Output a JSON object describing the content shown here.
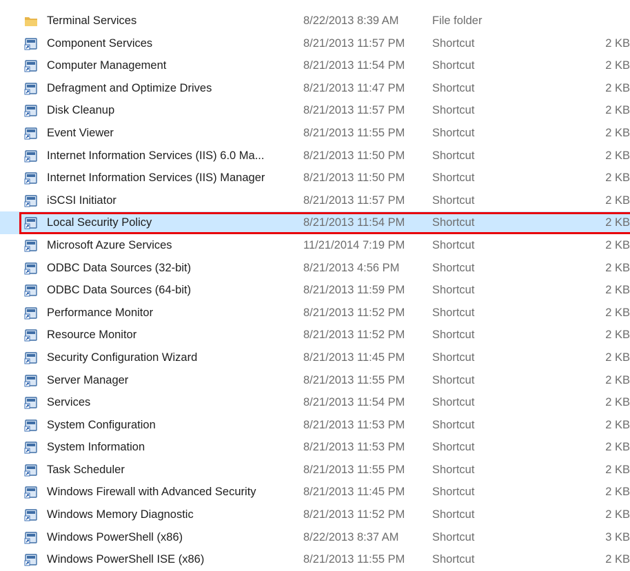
{
  "file_list": {
    "rows": [
      {
        "name": "Terminal Services",
        "date": "8/22/2013 8:39 AM",
        "type": "File folder",
        "size": "",
        "icon": "folder-icon"
      },
      {
        "name": "Component Services",
        "date": "8/21/2013 11:57 PM",
        "type": "Shortcut",
        "size": "2 KB",
        "icon": "component-services-icon"
      },
      {
        "name": "Computer Management",
        "date": "8/21/2013 11:54 PM",
        "type": "Shortcut",
        "size": "2 KB",
        "icon": "computer-management-icon"
      },
      {
        "name": "Defragment and Optimize Drives",
        "date": "8/21/2013 11:47 PM",
        "type": "Shortcut",
        "size": "2 KB",
        "icon": "defragment-icon"
      },
      {
        "name": "Disk Cleanup",
        "date": "8/21/2013 11:57 PM",
        "type": "Shortcut",
        "size": "2 KB",
        "icon": "disk-cleanup-icon"
      },
      {
        "name": "Event Viewer",
        "date": "8/21/2013 11:55 PM",
        "type": "Shortcut",
        "size": "2 KB",
        "icon": "event-viewer-icon"
      },
      {
        "name": "Internet Information Services (IIS) 6.0 Ma...",
        "date": "8/21/2013 11:50 PM",
        "type": "Shortcut",
        "size": "2 KB",
        "icon": "iis6-manager-icon"
      },
      {
        "name": "Internet Information Services (IIS) Manager",
        "date": "8/21/2013 11:50 PM",
        "type": "Shortcut",
        "size": "2 KB",
        "icon": "iis-manager-icon"
      },
      {
        "name": "iSCSI Initiator",
        "date": "8/21/2013 11:57 PM",
        "type": "Shortcut",
        "size": "2 KB",
        "icon": "iscsi-initiator-icon"
      },
      {
        "name": "Local Security Policy",
        "date": "8/21/2013 11:54 PM",
        "type": "Shortcut",
        "size": "2 KB",
        "icon": "local-security-policy-icon"
      },
      {
        "name": "Microsoft Azure Services",
        "date": "11/21/2014 7:19 PM",
        "type": "Shortcut",
        "size": "2 KB",
        "icon": "azure-services-icon"
      },
      {
        "name": "ODBC Data Sources (32-bit)",
        "date": "8/21/2013 4:56 PM",
        "type": "Shortcut",
        "size": "2 KB",
        "icon": "odbc-icon"
      },
      {
        "name": "ODBC Data Sources (64-bit)",
        "date": "8/21/2013 11:59 PM",
        "type": "Shortcut",
        "size": "2 KB",
        "icon": "odbc-icon"
      },
      {
        "name": "Performance Monitor",
        "date": "8/21/2013 11:52 PM",
        "type": "Shortcut",
        "size": "2 KB",
        "icon": "performance-monitor-icon"
      },
      {
        "name": "Resource Monitor",
        "date": "8/21/2013 11:52 PM",
        "type": "Shortcut",
        "size": "2 KB",
        "icon": "resource-monitor-icon"
      },
      {
        "name": "Security Configuration Wizard",
        "date": "8/21/2013 11:45 PM",
        "type": "Shortcut",
        "size": "2 KB",
        "icon": "security-wizard-icon"
      },
      {
        "name": "Server Manager",
        "date": "8/21/2013 11:55 PM",
        "type": "Shortcut",
        "size": "2 KB",
        "icon": "server-manager-icon"
      },
      {
        "name": "Services",
        "date": "8/21/2013 11:54 PM",
        "type": "Shortcut",
        "size": "2 KB",
        "icon": "services-icon"
      },
      {
        "name": "System Configuration",
        "date": "8/21/2013 11:53 PM",
        "type": "Shortcut",
        "size": "2 KB",
        "icon": "system-configuration-icon"
      },
      {
        "name": "System Information",
        "date": "8/21/2013 11:53 PM",
        "type": "Shortcut",
        "size": "2 KB",
        "icon": "system-information-icon"
      },
      {
        "name": "Task Scheduler",
        "date": "8/21/2013 11:55 PM",
        "type": "Shortcut",
        "size": "2 KB",
        "icon": "task-scheduler-icon"
      },
      {
        "name": "Windows Firewall with Advanced Security",
        "date": "8/21/2013 11:45 PM",
        "type": "Shortcut",
        "size": "2 KB",
        "icon": "firewall-icon"
      },
      {
        "name": "Windows Memory Diagnostic",
        "date": "8/21/2013 11:52 PM",
        "type": "Shortcut",
        "size": "2 KB",
        "icon": "memory-diagnostic-icon"
      },
      {
        "name": "Windows PowerShell (x86)",
        "date": "8/22/2013 8:37 AM",
        "type": "Shortcut",
        "size": "3 KB",
        "icon": "powershell-icon"
      },
      {
        "name": "Windows PowerShell ISE (x86)",
        "date": "8/21/2013 11:55 PM",
        "type": "Shortcut",
        "size": "2 KB",
        "icon": "powershell-ise-icon"
      }
    ],
    "selected_name": "Local Security Policy",
    "colors": {
      "selection_background": "#cce8ff",
      "highlight_outline": "#e8000b",
      "secondary_text": "#6d6d6d",
      "folder": "#e8b54a",
      "shortcut_tile": "#3f6ea6"
    }
  }
}
